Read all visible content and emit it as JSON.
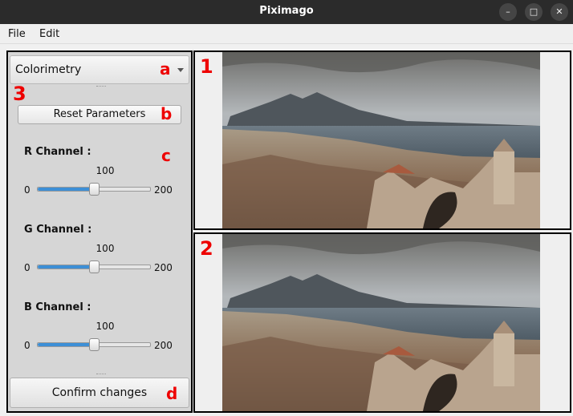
{
  "window": {
    "title": "Piximago",
    "minimize_glyph": "–",
    "maximize_glyph": "□",
    "close_glyph": "✕"
  },
  "menu": {
    "file": "File",
    "edit": "Edit"
  },
  "panel": {
    "mode": "Colorimetry",
    "reset_label": "Reset Parameters",
    "confirm_label": "Confirm changes",
    "channels": [
      {
        "label": "R Channel :",
        "value": "100",
        "min": "0",
        "max": "200",
        "fraction": 0.5
      },
      {
        "label": "G Channel :",
        "value": "100",
        "min": "0",
        "max": "200",
        "fraction": 0.5
      },
      {
        "label": "B Channel :",
        "value": "100",
        "min": "0",
        "max": "200",
        "fraction": 0.5
      }
    ]
  },
  "annotations": {
    "a": "a",
    "b": "b",
    "c": "c",
    "d": "d",
    "n1": "1",
    "n2": "2",
    "n3": "3"
  },
  "colors": {
    "annotation": "#e00000",
    "slider_fill": "#3d8fd6",
    "titlebar": "#2b2b2b"
  }
}
